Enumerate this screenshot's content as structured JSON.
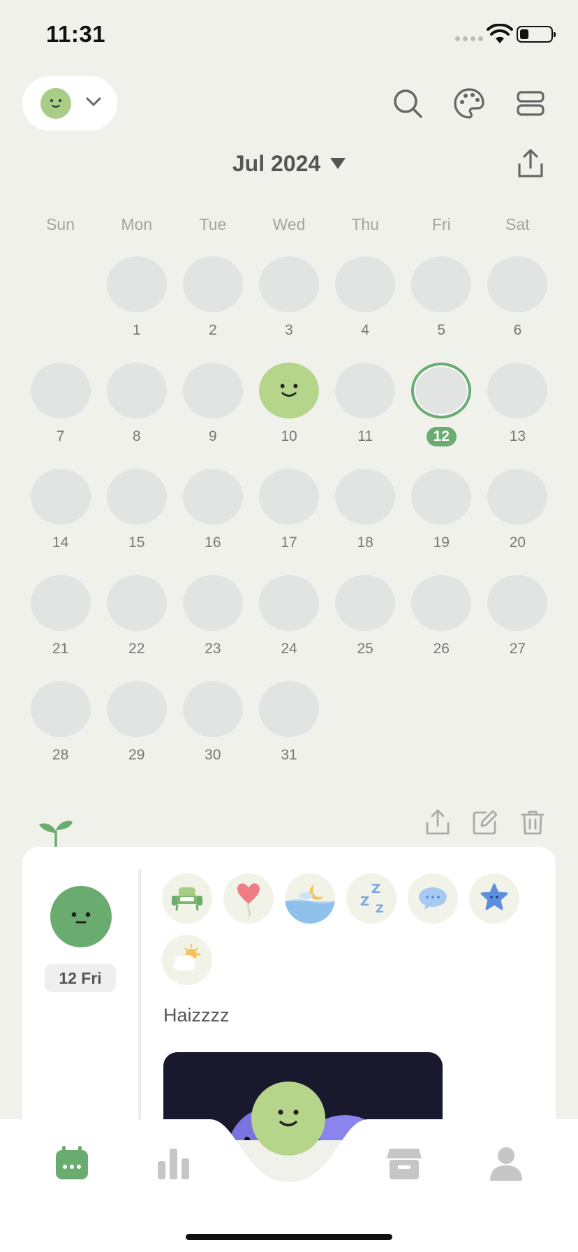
{
  "status_bar": {
    "time": "11:31"
  },
  "header": {
    "month": "Jul 2024",
    "icons": [
      "search-icon",
      "palette-icon",
      "layout-icon",
      "share-icon"
    ]
  },
  "weekdays": [
    "Sun",
    "Mon",
    "Tue",
    "Wed",
    "Thu",
    "Fri",
    "Sat"
  ],
  "calendar": {
    "leading_blank_days": 1,
    "days": [
      "1",
      "2",
      "3",
      "4",
      "5",
      "6",
      "7",
      "8",
      "9",
      "10",
      "11",
      "12",
      "13",
      "14",
      "15",
      "16",
      "17",
      "18",
      "19",
      "20",
      "21",
      "22",
      "23",
      "24",
      "25",
      "26",
      "27",
      "28",
      "29",
      "30",
      "31"
    ],
    "mood_day": "10",
    "today": "12"
  },
  "entry": {
    "date_label": "12 Fri",
    "note": "Haizzzz",
    "activity_icons": [
      "sofa-icon",
      "balloon-icon",
      "night-sea-icon",
      "sleep-icon",
      "chat-bubble-icon",
      "star-icon",
      "partly-cloudy-icon"
    ]
  },
  "tabbar": {
    "items": [
      "calendar-tab",
      "stats-tab",
      "add-mood-tab",
      "store-tab",
      "profile-tab"
    ],
    "active_color": "#6aab6f",
    "inactive_color": "#c6c6c6"
  },
  "colors": {
    "background": "#f1f1ec",
    "accent": "#6aab6f",
    "mood_light_green": "#b5d58a",
    "empty_day": "#e2e3e3"
  }
}
